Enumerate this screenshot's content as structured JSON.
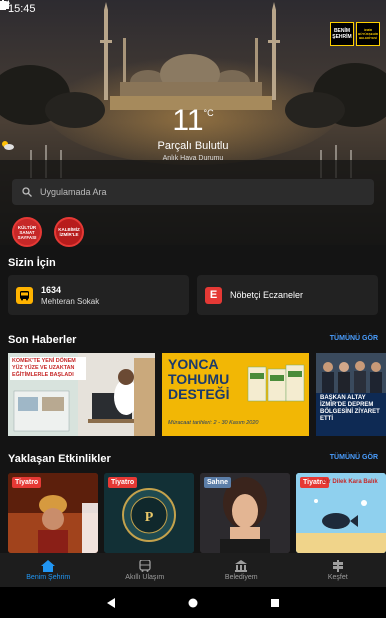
{
  "status": {
    "time": "15:45"
  },
  "header": {
    "logo_left": "BENİM ŞEHRİM",
    "logo_right": "İZMİR BÜYÜKŞEHİR BELEDİYESİ"
  },
  "weather": {
    "temp": "11",
    "unit": "°C",
    "condition": "Parçalı Bulutlu",
    "subtitle": "Anlık Hava Durumu"
  },
  "search": {
    "placeholder": "Uygulamada Ara"
  },
  "stories": [
    {
      "label": "KÜLTÜR SANAT SAYFASI"
    },
    {
      "label": "KALBİMİZ İZMİR'LE"
    }
  ],
  "for_you": {
    "title": "Sizin İçin",
    "cards": [
      {
        "icon": "bus-icon",
        "line": "1634",
        "stop": "Mehteran Sokak"
      },
      {
        "icon": "pharmacy-icon",
        "letter": "E",
        "label": "Nöbetçi Eczaneler"
      }
    ]
  },
  "news": {
    "title": "Son Haberler",
    "see_all": "TÜMÜNÜ GÖR",
    "items": [
      {
        "text": "KOMEK'TE YENİ DÖNEM YÜZ YÜZE VE UZAKTAN EĞİTİMLERLE BAŞLADI"
      },
      {
        "headline1": "YONCA",
        "headline2": "TOHUMU",
        "headline3": "DESTEĞİ",
        "sub": "Müracaat tarihleri: 2 - 30 Kasım 2020"
      },
      {
        "text": "BAŞKAN ALTAY İZMİR'DE DEPREM BÖLGESİNİ ZİYARET ETTİ"
      }
    ]
  },
  "events": {
    "title": "Yaklaşan Etkinlikler",
    "see_all": "TÜMÜNÜ GÖR",
    "items": [
      {
        "tag": "Tiyatro",
        "tag_color": "#e53935"
      },
      {
        "tag": "Tiyatro",
        "tag_color": "#e53935"
      },
      {
        "tag": "Sahne",
        "tag_color": "#5c7ea8"
      },
      {
        "tag": "Tiyatro",
        "tag_color": "#e53935",
        "poster": "Bir Dilek Kara Balık"
      }
    ]
  },
  "bottom_nav": [
    {
      "label": "Benim Şehrim",
      "icon": "home-icon",
      "active": true
    },
    {
      "label": "Akıllı Ulaşım",
      "icon": "bus-icon",
      "active": false
    },
    {
      "label": "Belediyem",
      "icon": "building-icon",
      "active": false
    },
    {
      "label": "Keşfet",
      "icon": "signpost-icon",
      "active": false
    }
  ],
  "colors": {
    "accent": "#2196f3",
    "link": "#4a9eff",
    "bus": "#ffb300",
    "pharmacy": "#e53935"
  }
}
